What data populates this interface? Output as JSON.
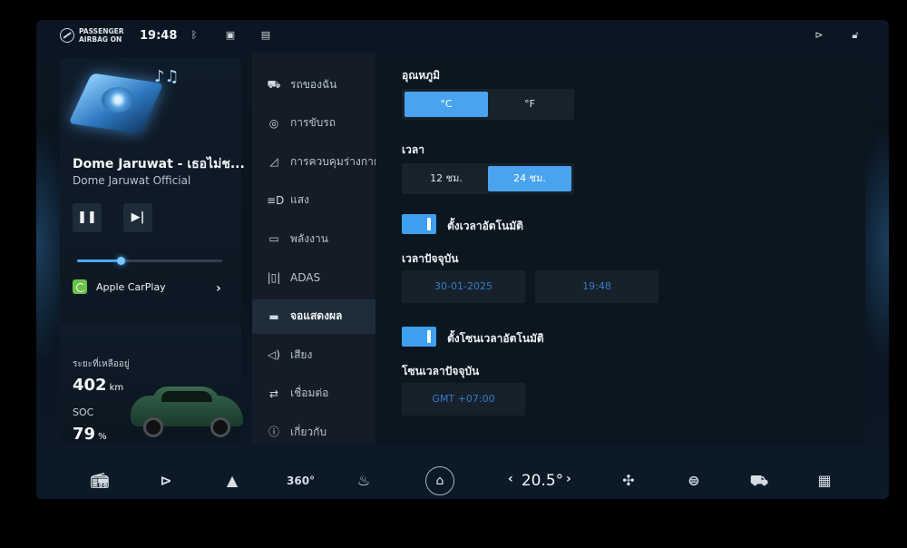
{
  "status_bar": {
    "airbag_line1": "PASSENGER",
    "airbag_line2": "AIRBAG ON",
    "time": "19:48",
    "icons": [
      "airbag-icon",
      "bluetooth-icon",
      "car-icon",
      "message-icon",
      "play-circle-icon",
      "lock-open-icon"
    ]
  },
  "media": {
    "title": "Dome Jaruwat - เธอไม่ช...",
    "artist": "Dome Jaruwat Official",
    "play_icon": "❚❚",
    "next_icon": "▶|",
    "progress_fraction": 0.3,
    "source_label": "Apple CarPlay",
    "source_chevron": "›"
  },
  "vehicle": {
    "range_label": "ระยะที่เหลืออยู่",
    "range_value": "402",
    "range_unit": "km",
    "soc_label": "SOC",
    "soc_value": "79",
    "soc_unit": "%"
  },
  "nav": {
    "items": [
      {
        "label": "รถของฉัน",
        "icon": "car-icon",
        "glyph": "⛟"
      },
      {
        "label": "การขับรถ",
        "icon": "steering-wheel-icon",
        "glyph": "◎"
      },
      {
        "label": "การควบคุมร่างกาย",
        "icon": "car-door-icon",
        "glyph": "◿"
      },
      {
        "label": "แสง",
        "icon": "headlight-icon",
        "glyph": "≡D"
      },
      {
        "label": "พลังงาน",
        "icon": "battery-icon",
        "glyph": "▭"
      },
      {
        "label": "ADAS",
        "icon": "lane-assist-icon",
        "glyph": "|▯|"
      },
      {
        "label": "จอแสดงผล",
        "icon": "display-icon",
        "glyph": "▬"
      },
      {
        "label": "เสียง",
        "icon": "speaker-icon",
        "glyph": "◁)"
      },
      {
        "label": "เชื่อมต่อ",
        "icon": "connection-icon",
        "glyph": "⇄"
      },
      {
        "label": "เกี่ยวกับ",
        "icon": "info-icon",
        "glyph": "ⓘ"
      }
    ],
    "active_index": 6
  },
  "settings": {
    "temperature": {
      "label": "อุณหภูมิ",
      "options": [
        "°C",
        "°F"
      ],
      "selected": 0
    },
    "time_format": {
      "label": "เวลา",
      "options": [
        "12 ชม.",
        "24 ชม."
      ],
      "selected": 1
    },
    "auto_time": {
      "label": "ตั้งเวลาอัตโนมัติ",
      "on": true
    },
    "current_time": {
      "label": "เวลาปัจจุบัน",
      "date": "30-01-2025",
      "time": "19:48"
    },
    "auto_timezone": {
      "label": "ตั้งโซนเวลาอัตโนมัติ",
      "on": true
    },
    "current_timezone": {
      "label": "โซนเวลาปัจจุบัน",
      "value": "GMT +07:00"
    }
  },
  "dock": {
    "temperature": "20.5",
    "temperature_unit": "°",
    "left_arrow": "‹",
    "right_arrow": "›",
    "home_glyph": "⌂",
    "icons": [
      "radio-icon",
      "media-play-icon",
      "navigation-icon",
      "camera-360-icon",
      "defrost-icon",
      "fan-icon",
      "car-climate-icon",
      "car-front-icon",
      "apps-grid-icon"
    ]
  },
  "colors": {
    "accent": "#4aa3ee",
    "background": "#0b1622"
  }
}
